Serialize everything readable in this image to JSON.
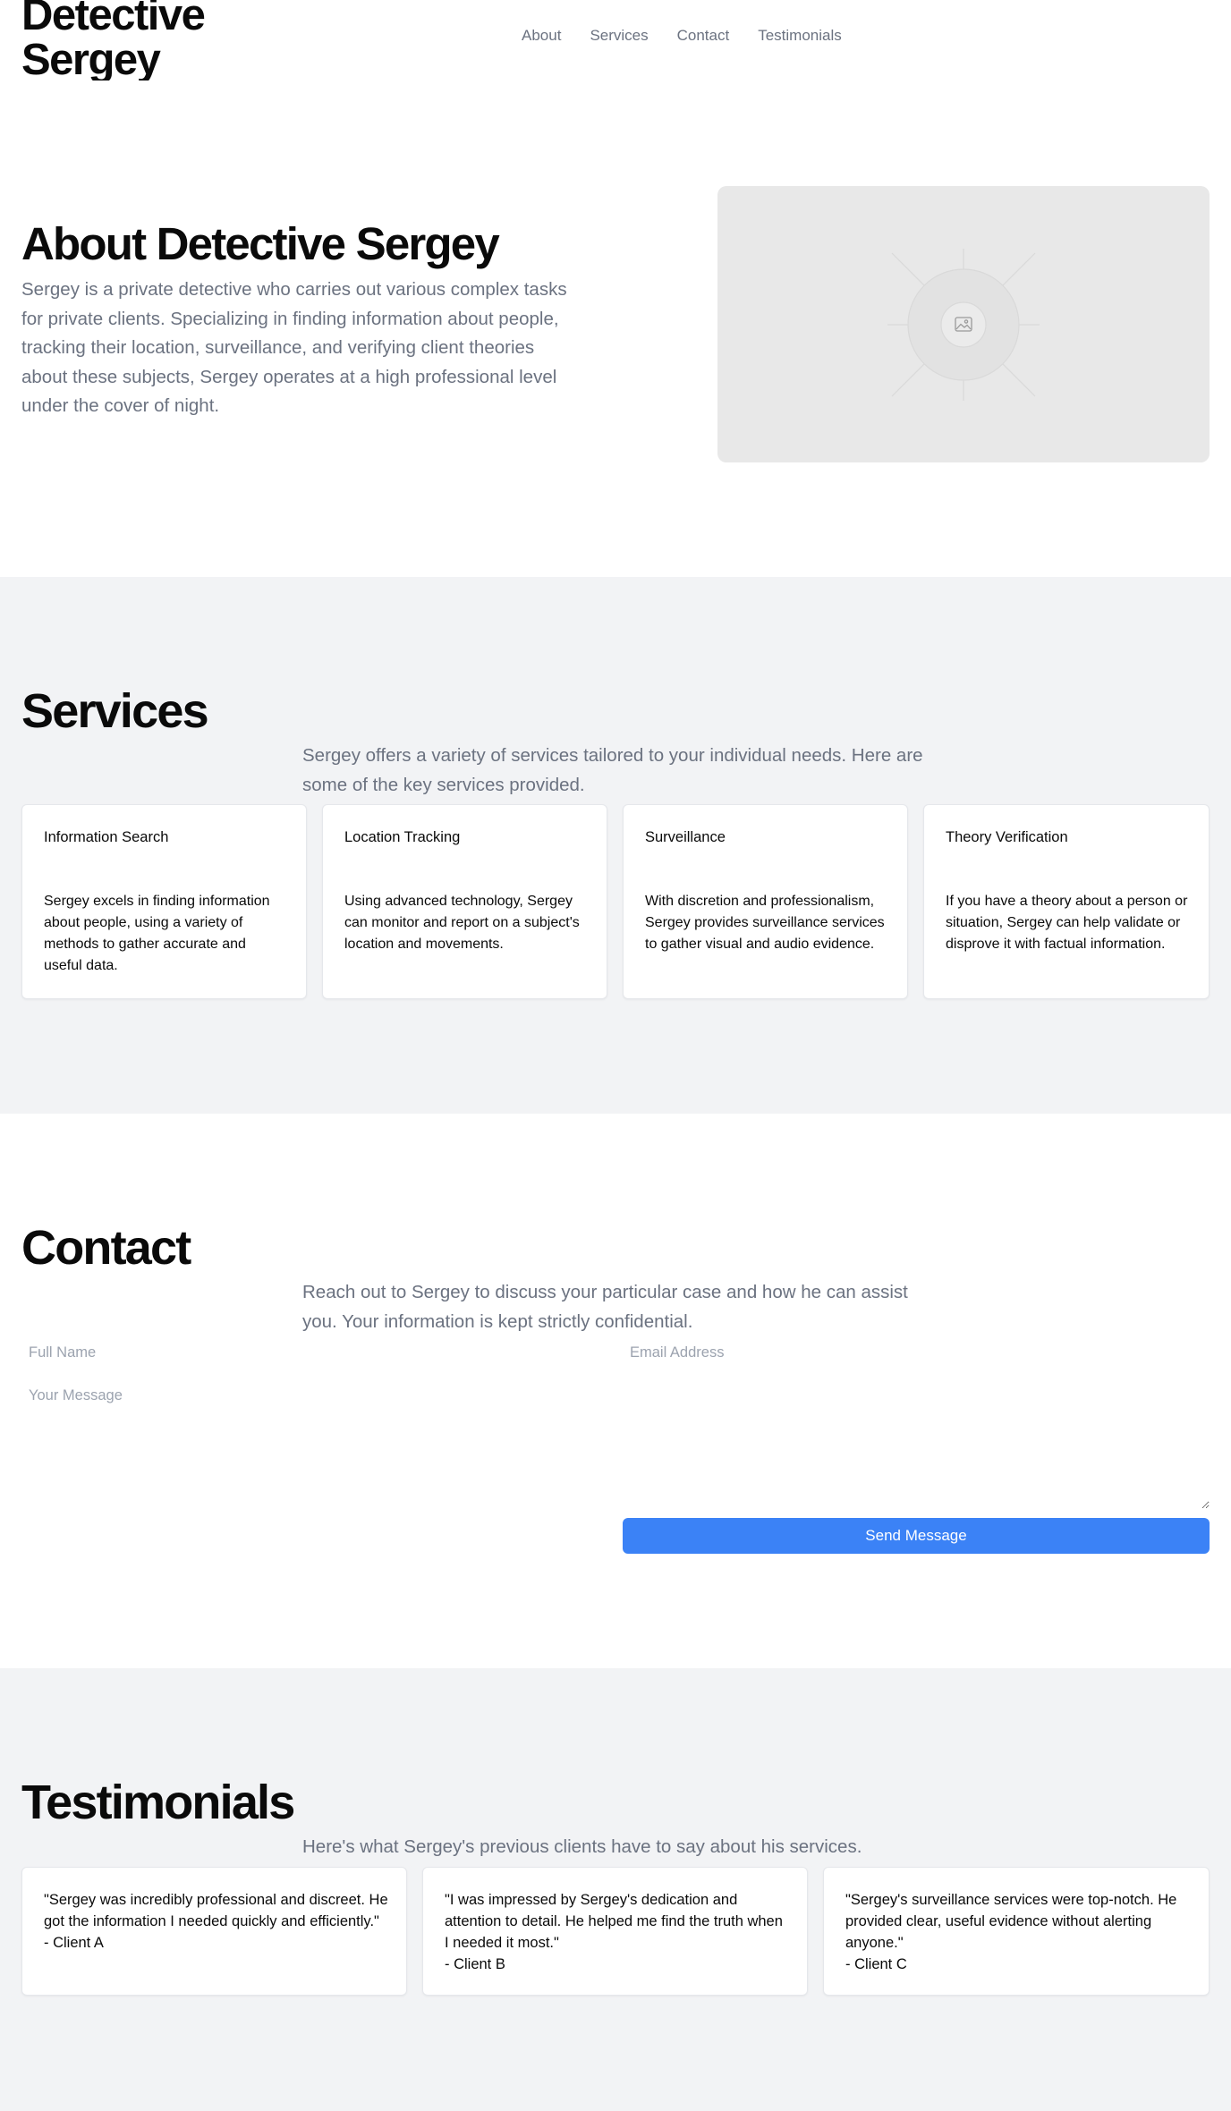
{
  "header": {
    "logo_line1": "Detective",
    "logo_line2": "Sergey",
    "nav": [
      "About",
      "Services",
      "Contact",
      "Testimonials"
    ]
  },
  "about": {
    "title": "About Detective Sergey",
    "text": "Sergey is a private detective who carries out various complex tasks for private clients. Specializing in finding information about people, tracking their location, surveillance, and verifying client theories about these subjects, Sergey operates at a high professional level under the cover of night.",
    "image_icon": "image-placeholder-icon"
  },
  "services": {
    "title": "Services",
    "description": "Sergey offers a variety of services tailored to your individual needs. Here are some of the key services provided.",
    "items": [
      {
        "title": "Information Search",
        "body": "Sergey excels in finding information about people, using a variety of methods to gather accurate and useful data."
      },
      {
        "title": "Location Tracking",
        "body": "Using advanced technology, Sergey can monitor and report on a subject's location and movements."
      },
      {
        "title": "Surveillance",
        "body": "With discretion and professionalism, Sergey provides surveillance services to gather visual and audio evidence."
      },
      {
        "title": "Theory Verification",
        "body": "If you have a theory about a person or situation, Sergey can help validate or disprove it with factual information."
      }
    ]
  },
  "contact": {
    "title": "Contact",
    "description": "Reach out to Sergey to discuss your particular case and how he can assist you. Your information is kept strictly confidential.",
    "name_placeholder": "Full Name",
    "email_placeholder": "Email Address",
    "message_placeholder": "Your Message",
    "send_label": "Send Message"
  },
  "testimonials": {
    "title": "Testimonials",
    "description": "Here's what Sergey's previous clients have to say about his services.",
    "items": [
      {
        "quote": "\"Sergey was incredibly professional and discreet. He got the information I needed quickly and efficiently.\"",
        "author": "- Client A"
      },
      {
        "quote": "\"I was impressed by Sergey's dedication and attention to detail. He helped me find the truth when I needed it most.\"",
        "author": "- Client B"
      },
      {
        "quote": "\"Sergey's surveillance services were top-notch. He provided clear, useful evidence without alerting anyone.\"",
        "author": "- Client C"
      }
    ]
  },
  "colors": {
    "accent": "#3b82f6",
    "muted_text": "#6b7280",
    "section_alt_bg": "#f2f3f5"
  }
}
